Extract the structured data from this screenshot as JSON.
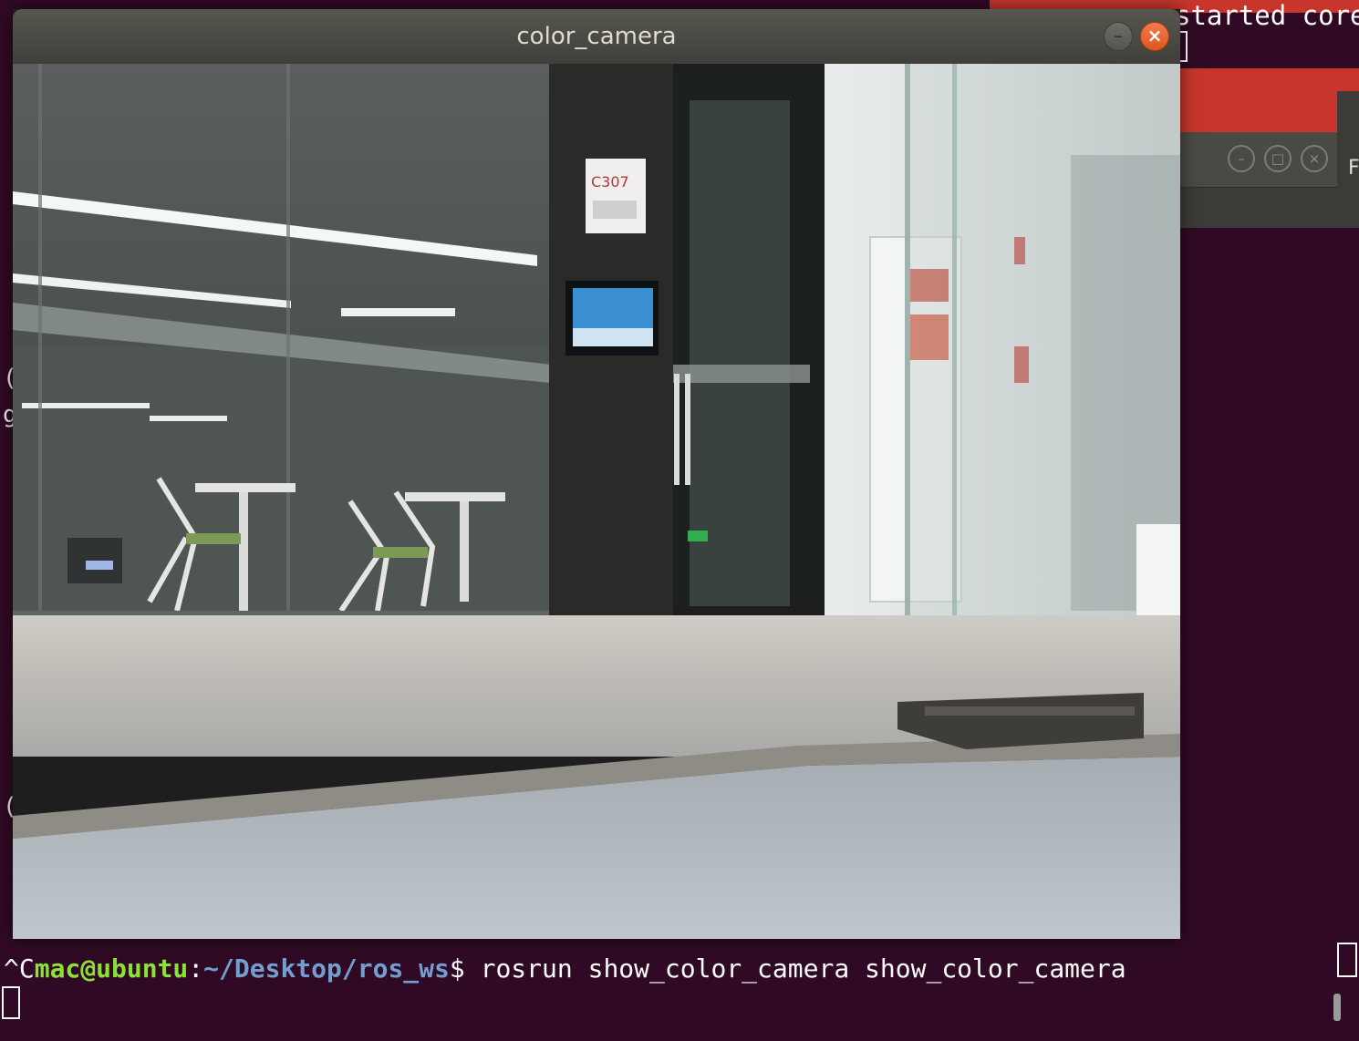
{
  "camera_window": {
    "title": "color_camera",
    "minimize_label": "–",
    "close_label": "×",
    "room_sign": "C307"
  },
  "background": {
    "top_right_text": "started core",
    "dialog_controls": [
      "–",
      "□",
      "×"
    ],
    "right_panel_char": "F",
    "left_fragments": [
      "(",
      "g",
      "("
    ]
  },
  "terminal": {
    "interrupt": "^C",
    "user_host": "mac@ubuntu",
    "separator": ":",
    "path": "~/Desktop/ros_ws",
    "prompt_symbol": "$ ",
    "command": "rosrun show_color_camera show_color_camera"
  }
}
